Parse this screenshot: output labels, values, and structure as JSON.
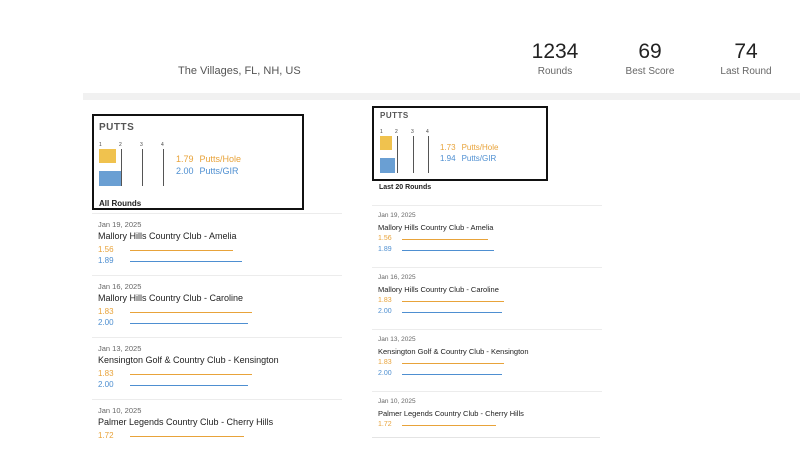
{
  "header": {
    "location": "The Villages, FL, NH, US",
    "stats": [
      {
        "value": "1234",
        "label": "Rounds"
      },
      {
        "value": "69",
        "label": "Best Score"
      },
      {
        "value": "74",
        "label": "Last Round"
      }
    ]
  },
  "colors": {
    "putts_per_hole": "#e8a33a",
    "putts_per_gir": "#4e8fd1",
    "frame": "#111111"
  },
  "gauge_ticks": [
    "1",
    "2",
    "3",
    "4"
  ],
  "left_panel": {
    "title": "PUTTS",
    "putts_per_hole": "1.79",
    "putts_per_hole_label": "Putts/Hole",
    "putts_per_gir": "2.00",
    "putts_per_gir_label": "Putts/GIR",
    "scope_label": "All Rounds",
    "rounds": [
      {
        "date": "Jan 19, 2025",
        "course": "Mallory Hills Country Club - Amelia",
        "putts_per_hole": "1.56",
        "putts_per_gir": "1.89"
      },
      {
        "date": "Jan 16, 2025",
        "course": "Mallory Hills Country Club - Caroline",
        "putts_per_hole": "1.83",
        "putts_per_gir": "2.00"
      },
      {
        "date": "Jan 13, 2025",
        "course": "Kensington Golf & Country Club - Kensington",
        "putts_per_hole": "1.83",
        "putts_per_gir": "2.00"
      },
      {
        "date": "Jan 10, 2025",
        "course": "Palmer Legends Country Club - Cherry Hills",
        "putts_per_hole": "1.72",
        "putts_per_gir": ""
      }
    ]
  },
  "right_panel": {
    "title": "PUTTS",
    "putts_per_hole": "1.73",
    "putts_per_hole_label": "Putts/Hole",
    "putts_per_gir": "1.94",
    "putts_per_gir_label": "Putts/GIR",
    "scope_label": "Last 20 Rounds",
    "rounds": [
      {
        "date": "Jan 19, 2025",
        "course": "Mallory Hills Country Club - Amelia",
        "putts_per_hole": "1.56",
        "putts_per_gir": "1.89"
      },
      {
        "date": "Jan 16, 2025",
        "course": "Mallory Hills Country Club - Caroline",
        "putts_per_hole": "1.83",
        "putts_per_gir": "2.00"
      },
      {
        "date": "Jan 13, 2025",
        "course": "Kensington Golf & Country Club - Kensington",
        "putts_per_hole": "1.83",
        "putts_per_gir": "2.00"
      },
      {
        "date": "Jan 10, 2025",
        "course": "Palmer Legends Country Club - Cherry Hills",
        "putts_per_hole": "1.72",
        "putts_per_gir": ""
      }
    ]
  }
}
